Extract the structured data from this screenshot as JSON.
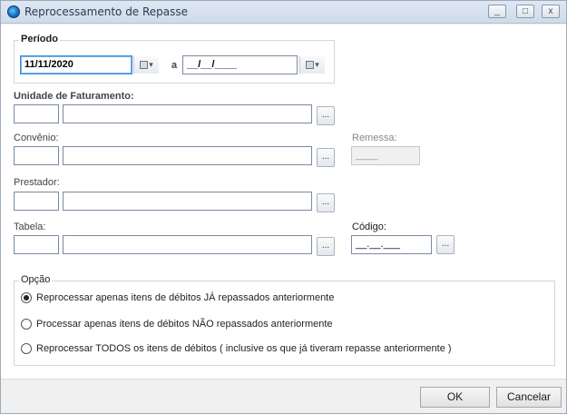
{
  "window": {
    "title": "Reprocessamento de Repasse",
    "controls": {
      "minimize": "_",
      "maximize": "□",
      "close": "x"
    }
  },
  "periodo": {
    "legend": "Período",
    "start_date": "11/11/2020",
    "separator": "a",
    "end_date": "__/__/____",
    "dropdown_glyph": "▾"
  },
  "unidade": {
    "label": "Unidade de Faturamento:",
    "code": "",
    "name": "",
    "lookup": "..."
  },
  "convenio": {
    "label": "Convênio:",
    "code": "",
    "name": "",
    "lookup": "..."
  },
  "remessa": {
    "label": "Remessa:",
    "value": "____"
  },
  "prestador": {
    "label": "Prestador:",
    "code": "",
    "name": "",
    "lookup": "..."
  },
  "tabela": {
    "label": "Tabela:",
    "code": "",
    "name": "",
    "lookup": "..."
  },
  "codigo": {
    "label": "Código:",
    "value": "__.__.___",
    "lookup": "..."
  },
  "opcao": {
    "legend": "Opção",
    "options": [
      {
        "label": "Reprocessar apenas itens de débitos JÁ repassados anteriormente",
        "selected": true
      },
      {
        "label": "Processar apenas itens de débitos NÃO repassados anteriormente",
        "selected": false
      },
      {
        "label": "Reprocessar TODOS os itens de débitos ( inclusive os que já tiveram repasse anteriormente )",
        "selected": false
      }
    ]
  },
  "buttons": {
    "ok": "OK",
    "cancel": "Cancelar"
  },
  "colors": {
    "focus_border": "#3a8ee6",
    "title_bar": "#dfe7f2"
  }
}
